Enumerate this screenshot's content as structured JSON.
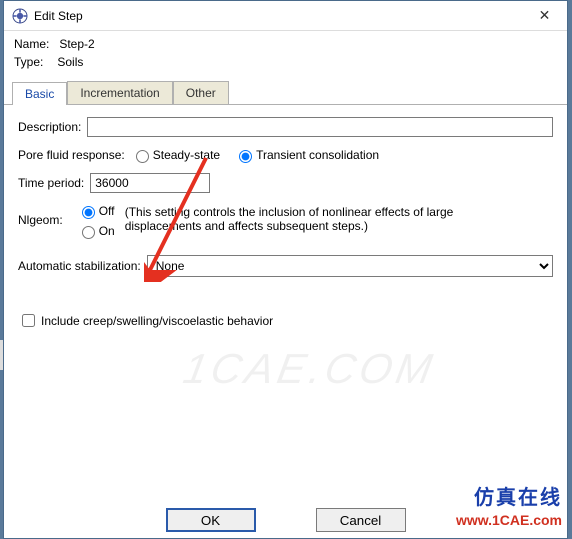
{
  "window": {
    "title": "Edit Step",
    "close_glyph": "✕"
  },
  "header": {
    "name_label": "Name:",
    "name_value": "Step-2",
    "type_label": "Type:",
    "type_value": "Soils"
  },
  "tabs": {
    "basic": "Basic",
    "incrementation": "Incrementation",
    "other": "Other"
  },
  "basic": {
    "description_label": "Description:",
    "description_value": "",
    "pore_label": "Pore fluid response:",
    "pore_steady": "Steady-state",
    "pore_transient": "Transient consolidation",
    "time_label": "Time period:",
    "time_value": "36000",
    "nlgeom_label": "Nlgeom:",
    "nlgeom_off": "Off",
    "nlgeom_on": "On",
    "nlgeom_note": "(This setting controls the inclusion of nonlinear effects of large displacements and affects subsequent steps.)",
    "autostab_label": "Automatic stabilization:",
    "autostab_value": "None",
    "creep_label": "Include creep/swelling/viscoelastic behavior"
  },
  "buttons": {
    "ok": "OK",
    "cancel": "Cancel"
  },
  "watermark": {
    "text": "1CAE.COM",
    "brand_cn": "仿真在线",
    "brand_url": "www.1CAE.com"
  }
}
